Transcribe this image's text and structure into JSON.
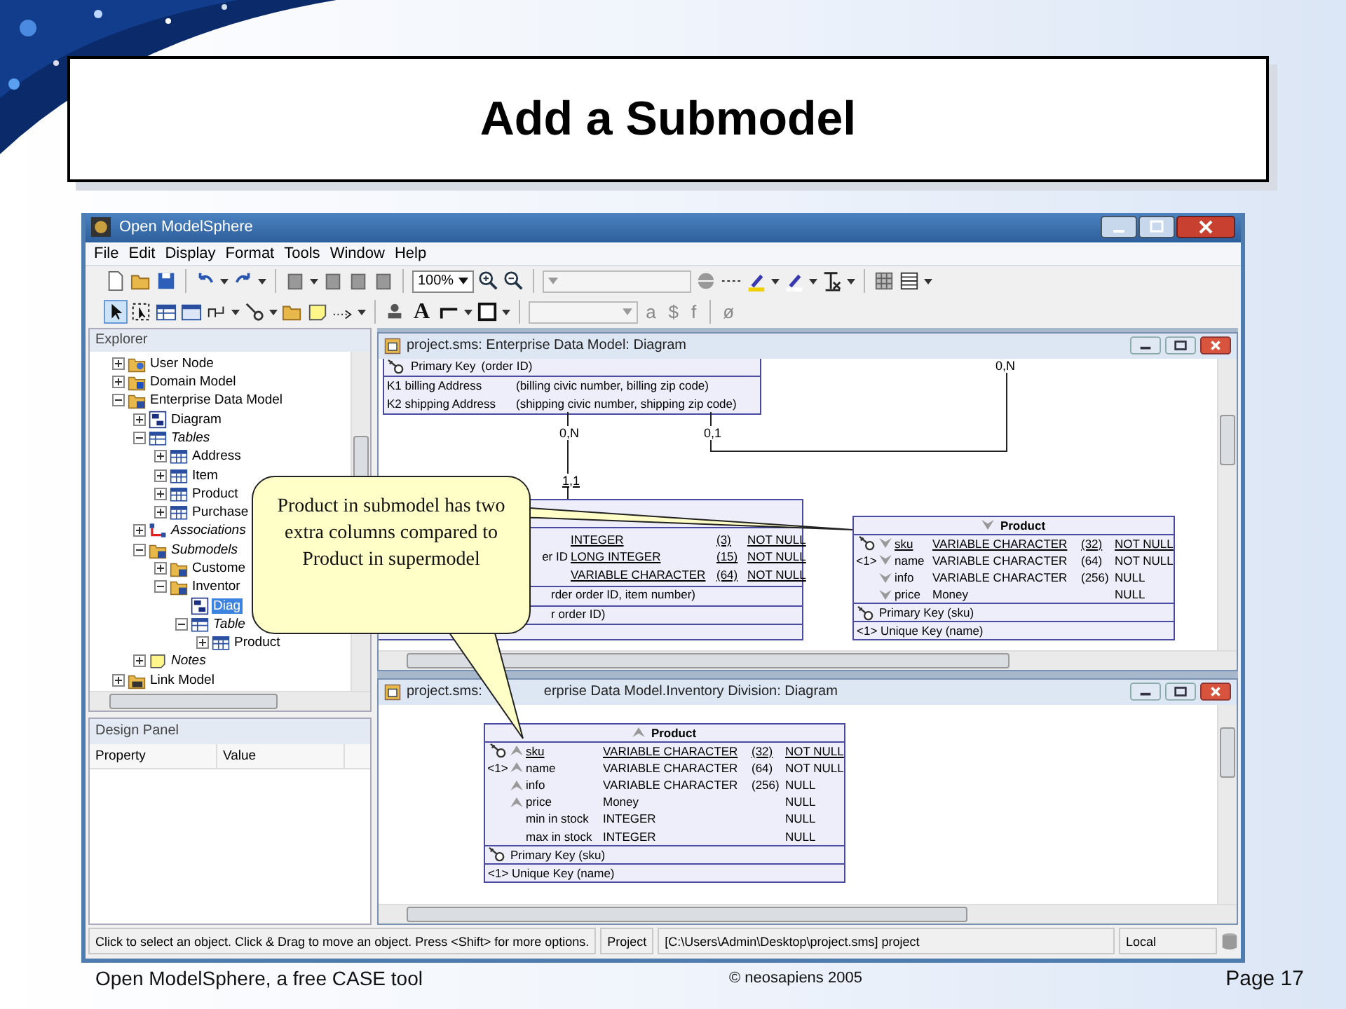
{
  "slide": {
    "title": "Add a Submodel",
    "footer": [
      "Open ModelSphere, a free CASE tool",
      "© neosapiens 2005",
      "Page 17"
    ]
  },
  "window": {
    "title": "Open ModelSphere"
  },
  "menu": [
    "File",
    "Edit",
    "Display",
    "Format",
    "Tools",
    "Window",
    "Help"
  ],
  "toolbar": {
    "zoom": "100%",
    "text_tool": "A",
    "glyphs": [
      "a",
      "$",
      "f",
      "ø"
    ]
  },
  "explorer": {
    "title": "Explorer",
    "tree": [
      {
        "label": "User Node",
        "kind": "user-folder",
        "expanded": false,
        "selected": false
      },
      {
        "label": "Domain Model",
        "kind": "domain-folder",
        "expanded": false,
        "selected": false
      },
      {
        "label": "Enterprise Data Model",
        "kind": "model-folder",
        "expanded": true,
        "selected": false,
        "children": [
          {
            "label": "Diagram",
            "kind": "diagram",
            "expanded": false,
            "selected": false
          },
          {
            "label": "Tables",
            "kind": "tables",
            "expanded": true,
            "selected": false,
            "children": [
              {
                "label": "Address",
                "kind": "table",
                "expanded": false,
                "selected": false
              },
              {
                "label": "Item",
                "kind": "table",
                "expanded": false,
                "selected": false
              },
              {
                "label": "Product",
                "kind": "table",
                "expanded": false,
                "selected": false
              },
              {
                "label": "Purchase",
                "kind": "table",
                "expanded": false,
                "selected": false
              }
            ]
          },
          {
            "label": "Associations",
            "kind": "associations",
            "expanded": false,
            "selected": false
          },
          {
            "label": "Submodels",
            "kind": "submodels",
            "expanded": true,
            "selected": false,
            "children": [
              {
                "label": "Custome",
                "kind": "model-folder",
                "expanded": false,
                "selected": false
              },
              {
                "label": "Inventor",
                "kind": "model-folder",
                "expanded": true,
                "selected": false,
                "children": [
                  {
                    "label": "Diag",
                    "kind": "diagram",
                    "selected": true
                  },
                  {
                    "label": "Table",
                    "kind": "tables",
                    "expanded": true,
                    "selected": false,
                    "children": [
                      {
                        "label": "Product",
                        "kind": "table",
                        "expanded": false,
                        "selected": false
                      }
                    ]
                  }
                ]
              }
            ]
          },
          {
            "label": "Notes",
            "kind": "notes",
            "expanded": false,
            "selected": false
          }
        ]
      },
      {
        "label": "Link Model",
        "kind": "link-folder",
        "expanded": false,
        "selected": false
      }
    ]
  },
  "design_panel": {
    "title": "Design Panel",
    "columns": [
      "Property",
      "Value"
    ]
  },
  "upper_frame": {
    "title": "project.sms: Enterprise Data Model: Diagram",
    "purchase_keys": [
      {
        "kind": "primary",
        "name": "Primary Key",
        "columns": "(order ID)"
      },
      {
        "kind": "key",
        "name": "K1 billing Address",
        "columns": "(billing civic number, billing zip code)"
      },
      {
        "kind": "key",
        "name": "K2 shipping Address",
        "columns": "(shipping civic number, shipping zip code)"
      }
    ],
    "cardinalities": [
      "0,N",
      "1,1",
      "0,1",
      "0,N"
    ],
    "item_rows": [
      {
        "type": "INTEGER",
        "length": "(3)",
        "null": "NOT NULL"
      },
      {
        "name": "er ID",
        "type": "LONG INTEGER",
        "length": "(15)",
        "null": "NOT NULL"
      },
      {
        "type": "VARIABLE CHARACTER",
        "length": "(64)",
        "null": "NOT NULL"
      }
    ],
    "item_keys": [
      "rder order ID, item number)",
      "r order ID)"
    ],
    "product": {
      "name": "Product",
      "kind": "down",
      "columns": [
        {
          "key": true,
          "chevron": true,
          "name": "sku",
          "type": "VARIABLE CHARACTER",
          "length": "(32)",
          "null": "NOT NULL"
        },
        {
          "marker": "<1>",
          "key": false,
          "chevron": true,
          "name": "name",
          "type": "VARIABLE CHARACTER",
          "length": "(64)",
          "null": "NOT NULL"
        },
        {
          "key": false,
          "chevron": true,
          "name": "info",
          "type": "VARIABLE CHARACTER",
          "length": "(256)",
          "null": "NULL"
        },
        {
          "key": false,
          "chevron": true,
          "name": "price",
          "type": "Money",
          "null": "NULL"
        }
      ],
      "primary_key": "Primary Key (sku)",
      "unique_key": "<1> Unique Key (name)"
    }
  },
  "lower_frame": {
    "title_parts": [
      "project.sms:",
      "erprise Data Model.Inventory Division: Diagram"
    ],
    "product": {
      "name": "Product",
      "kind": "up",
      "columns": [
        {
          "key": true,
          "chevron": true,
          "name": "sku",
          "type": "VARIABLE CHARACTER",
          "length": "(32)",
          "null": "NOT NULL"
        },
        {
          "marker": "<1>",
          "key": false,
          "chevron": true,
          "name": "name",
          "type": "VARIABLE CHARACTER",
          "length": "(64)",
          "null": "NOT NULL"
        },
        {
          "key": false,
          "chevron": true,
          "name": "info",
          "type": "VARIABLE CHARACTER",
          "length": "(256)",
          "null": "NULL"
        },
        {
          "key": false,
          "chevron": true,
          "name": "price",
          "type": "Money",
          "null": "NULL"
        },
        {
          "key": false,
          "chevron": false,
          "name": "min in stock",
          "type": "INTEGER",
          "null": "NULL"
        },
        {
          "key": false,
          "chevron": false,
          "name": "max in stock",
          "type": "INTEGER",
          "null": "NULL"
        }
      ],
      "primary_key": "Primary Key (sku)",
      "unique_key": "<1> Unique Key (name)"
    }
  },
  "callout": {
    "text": "Product in submodel has two extra columns compared to Product in supermodel"
  },
  "status_bar": {
    "message": "Click to select an object.  Click & Drag to move an object.  Press <Shift> for more options.",
    "label": "Project",
    "path": "[C:\\Users\\Admin\\Desktop\\project.sms]  project",
    "location": "Local"
  }
}
